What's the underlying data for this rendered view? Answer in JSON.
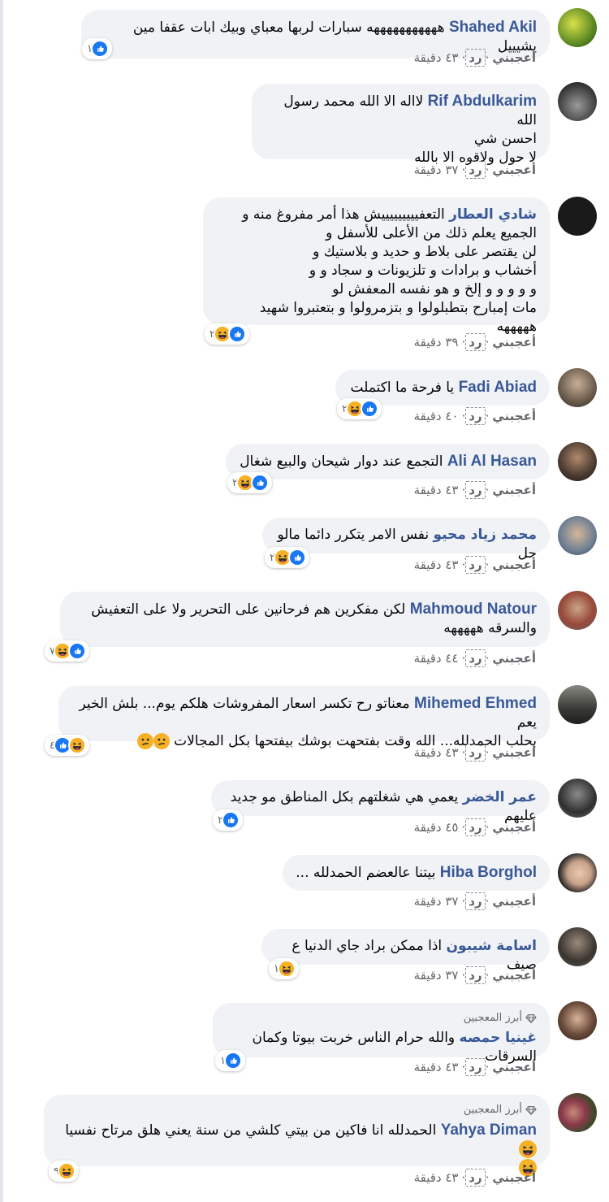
{
  "labels": {
    "like": "أعجبني",
    "reply": "رد",
    "top_fan": "أبرز المعجبين"
  },
  "colors": {
    "name": "#385898",
    "bubble": "#f0f2f5",
    "like": "#1877f2",
    "haha": "#f7b125"
  },
  "comments": [
    {
      "name": "Shahed Akil",
      "text": "هههههههههههه سبارات لربها معباي وبيك ابات عقفا مين يشيييل",
      "time": "٤٣ دقيقة",
      "reactions": [
        "like"
      ],
      "count": "١"
    },
    {
      "name": "Rif Abdulkarim",
      "line1": "لااله الا الله محمد رسول الله",
      "line2": "احسن شي",
      "line3": "لا حول ولاقوه الا بالله",
      "time": "٣٧ دقيقة"
    },
    {
      "name": "شادي العطار",
      "line1": "التعفيييييييييش هذا أمر مفروغ منه و",
      "line2": "الجميع يعلم ذلك من الأعلى للأسفل و",
      "line3": "لن يقتصر على بلاط و حديد و بلاستيك و",
      "line4": "أخشاب و برادات و تلزيونات و سجاد و و",
      "line5": "و و و و و إلخ و هو نفسه المعفش لو",
      "line6": "مات إمبارح بتطبلولوا و بتزمرولوا و بتعتبروا شهيد هههههه",
      "time": "٣٩ دقيقة",
      "reactions": [
        "like",
        "haha"
      ],
      "count": "٢"
    },
    {
      "name": "Fadi Abiad",
      "text": "يا فرحة ما اكتملت",
      "time": "٤٠ دقيقة",
      "reactions": [
        "like",
        "haha"
      ],
      "count": "٢"
    },
    {
      "name": "Ali Al Hasan",
      "text": "التجمع عند دوار شيحان والبيع شغال",
      "time": "٤٣ دقيقة",
      "reactions": [
        "like",
        "haha"
      ],
      "count": "٢"
    },
    {
      "name": "محمد زياد محيو",
      "text": "نفس الامر يتكرر دائما مالو حل",
      "time": "٤٣ دقيقة",
      "reactions": [
        "like",
        "haha"
      ],
      "count": "٢"
    },
    {
      "name": "Mahmoud Natour",
      "line1": "لكن مفكرين هم فرحانين على التحرير ولا على التعفيش",
      "line2": "والسرقه هههههه",
      "time": "٤٤ دقيقة",
      "reactions": [
        "like",
        "haha"
      ],
      "count": "٧"
    },
    {
      "name": "Mihemed Ehmed",
      "line1": "معناتو رح تكسر اسعار المفروشات هلكم يوم... بلش الخير يعم",
      "line2": "بحلب الحمدلله... الله وقت بفتحهت بوشك بيفتحها بكل المجالات",
      "time": "٤٣ دقيقة",
      "reactions": [
        "haha",
        "like"
      ],
      "count": "٤"
    },
    {
      "name": "عمر الخضر",
      "text": "يعمي هي شغلتهم بكل المناطق مو جديد عليهم",
      "time": "٤٥ دقيقة",
      "reactions": [
        "like"
      ],
      "count": "٢"
    },
    {
      "name": "Hiba Borghol",
      "text": "بيتنا عالعضم الحمدلله ...",
      "time": "٣٧ دقيقة"
    },
    {
      "name": "اسامة شيبون",
      "text": "اذا ممكن براد جاي الدنيا ع صيف",
      "time": "٣٧ دقيقة",
      "reactions": [
        "haha"
      ],
      "count": "١"
    },
    {
      "name": "غينيا حمصه",
      "text": "والله حرام الناس خربت بيوتا وكمان السرقات",
      "time": "٤٣ دقيقة",
      "reactions": [
        "like"
      ],
      "count": "١",
      "fan": true
    },
    {
      "name": "Yahya Diman",
      "text": "الحمدلله انا فاكين من بيتي كلشي من سنة يعني هلق مرتاح نفسيا",
      "time": "٤٣ دقيقة",
      "reactions": [
        "haha"
      ],
      "count": "٩",
      "fan": true
    }
  ]
}
